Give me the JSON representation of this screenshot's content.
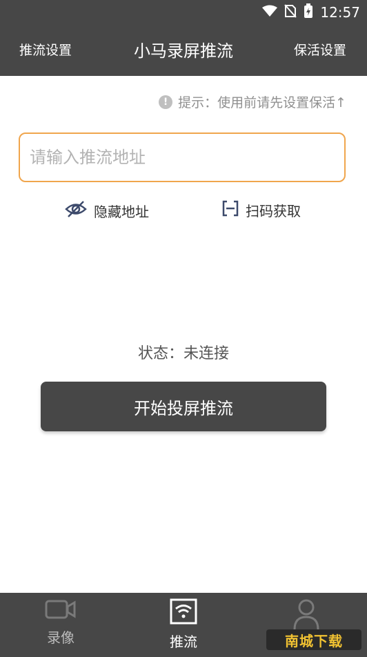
{
  "status_bar": {
    "time": "12:57"
  },
  "header": {
    "left_label": "推流设置",
    "title": "小马录屏推流",
    "right_label": "保活设置"
  },
  "hint": {
    "icon": "info-icon",
    "text": "提示：使用前请先设置保活↑"
  },
  "url_input": {
    "placeholder": "请输入推流地址",
    "value": ""
  },
  "actions": {
    "hide_label": "隐藏地址",
    "scan_label": "扫码获取"
  },
  "status": {
    "text": "状态：未连接"
  },
  "start_button": {
    "label": "开始投屏推流"
  },
  "bottom_nav": {
    "items": [
      {
        "label": "录像",
        "icon": "video-camera-icon"
      },
      {
        "label": "推流",
        "icon": "wifi-stream-icon"
      },
      {
        "label": "",
        "icon": "person-icon"
      }
    ]
  },
  "watermark": {
    "text": "南城下载"
  },
  "colors": {
    "bar_bg": "#474747",
    "input_border": "#f0a54c",
    "hint_text": "#8f8f8f"
  }
}
